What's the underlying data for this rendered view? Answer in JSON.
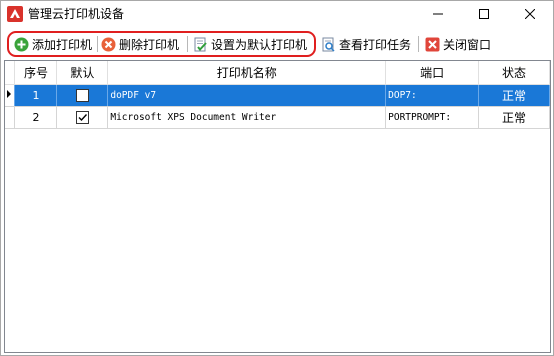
{
  "window": {
    "title": "管理云打印机设备",
    "controls": [
      "minimize-icon",
      "maximize-icon",
      "close-icon"
    ]
  },
  "toolbar": {
    "add_printer": "添加打印机",
    "delete_printer": "删除打印机",
    "set_default": "设置为默认打印机",
    "view_jobs": "查看打印任务",
    "close_window": "关闭窗口",
    "icons": {
      "add": "plus-circle-icon",
      "delete": "x-circle-icon",
      "set_default": "document-check-icon",
      "view_jobs": "document-view-icon",
      "close": "close-box-icon"
    }
  },
  "table": {
    "columns": [
      "序号",
      "默认",
      "打印机名称",
      "端口",
      "状态"
    ],
    "rows": [
      {
        "index": "1",
        "default": false,
        "name": "doPDF v7",
        "port": "DOP7:",
        "status": "正常",
        "selected": true
      },
      {
        "index": "2",
        "default": true,
        "name": "Microsoft XPS Document Writer",
        "port": "PORTPROMPT:",
        "status": "正常",
        "selected": false
      }
    ]
  },
  "colors": {
    "selection": "#1a78d7",
    "highlight_border": "#e01f1f"
  }
}
